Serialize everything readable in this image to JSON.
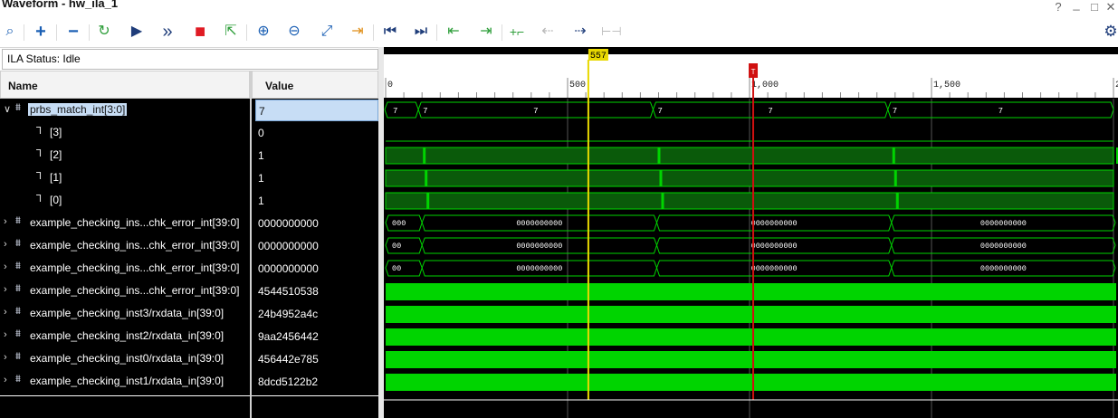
{
  "window": {
    "title": "Waveform - hw_ila_1",
    "controls": [
      "?",
      "_",
      "□",
      "✕"
    ]
  },
  "toolbar": {
    "buttons": [
      {
        "name": "search-icon",
        "glyph": "⌕"
      },
      {
        "name": "add-icon",
        "glyph": "+"
      },
      {
        "name": "remove-icon",
        "glyph": "−"
      },
      {
        "name": "run-trigger-immediate-icon",
        "glyph": "↻"
      },
      {
        "name": "run-trigger-icon",
        "glyph": "▶"
      },
      {
        "name": "run-trigger-all-icon",
        "glyph": "»"
      },
      {
        "name": "stop-icon",
        "glyph": "■"
      },
      {
        "name": "export-icon",
        "glyph": "⇱"
      },
      {
        "name": "zoom-in-icon",
        "glyph": "⊕"
      },
      {
        "name": "zoom-out-icon",
        "glyph": "⊖"
      },
      {
        "name": "zoom-fit-icon",
        "glyph": "⤢"
      },
      {
        "name": "go-to-cursor-icon",
        "glyph": "⇥"
      },
      {
        "name": "go-to-start-icon",
        "glyph": "⏮"
      },
      {
        "name": "go-to-end-icon",
        "glyph": "⏭"
      },
      {
        "name": "previous-transition-icon",
        "glyph": "⇤"
      },
      {
        "name": "next-transition-icon",
        "glyph": "⇥"
      },
      {
        "name": "add-marker-icon",
        "glyph": "+⌐"
      },
      {
        "name": "previous-marker-icon",
        "glyph": "⇠"
      },
      {
        "name": "next-marker-icon",
        "glyph": "⇢"
      },
      {
        "name": "swap-cursors-icon",
        "glyph": "⊢⊣"
      }
    ],
    "settings_icon": "⚙"
  },
  "status": {
    "text": "ILA Status: Idle"
  },
  "columns": {
    "name": "Name",
    "value": "Value"
  },
  "rows": [
    {
      "name": "prbs_match_int[3:0]",
      "value": "7",
      "type": "bus",
      "indent": 0,
      "selected": true
    },
    {
      "name": "[3]",
      "value": "0",
      "type": "bit",
      "indent": 1
    },
    {
      "name": "[2]",
      "value": "1",
      "type": "bit",
      "indent": 1
    },
    {
      "name": "[1]",
      "value": "1",
      "type": "bit",
      "indent": 1
    },
    {
      "name": "[0]",
      "value": "1",
      "type": "bit",
      "indent": 1
    },
    {
      "name": "example_checking_ins...chk_error_int[39:0]",
      "value": "0000000000",
      "type": "bus",
      "indent": 0
    },
    {
      "name": "example_checking_ins...chk_error_int[39:0]",
      "value": "0000000000",
      "type": "bus",
      "indent": 0
    },
    {
      "name": "example_checking_ins...chk_error_int[39:0]",
      "value": "0000000000",
      "type": "bus",
      "indent": 0
    },
    {
      "name": "example_checking_ins...chk_error_int[39:0]",
      "value": "4544510538",
      "type": "bus",
      "indent": 0
    },
    {
      "name": "example_checking_inst3/rxdata_in[39:0]",
      "value": "24b4952a4c",
      "type": "bus",
      "indent": 0
    },
    {
      "name": "example_checking_inst2/rxdata_in[39:0]",
      "value": "9aa2456442",
      "type": "bus",
      "indent": 0
    },
    {
      "name": "example_checking_inst0/rxdata_in[39:0]",
      "value": "456442e785",
      "type": "bus",
      "indent": 0
    },
    {
      "name": "example_checking_inst1/rxdata_in[39:0]",
      "value": "8dcd5122b2",
      "type": "bus",
      "indent": 0
    }
  ],
  "timeline": {
    "range": [
      0,
      2000
    ],
    "tick_labels": [
      {
        "value": 0,
        "label": "0"
      },
      {
        "value": 500,
        "label": "500"
      },
      {
        "value": 1000,
        "label": "1,000"
      },
      {
        "value": 1500,
        "label": "1,500"
      },
      {
        "value": 2000,
        "label": "2,0"
      }
    ],
    "cursor": {
      "value": 557,
      "label": "557",
      "color": "#e8d800"
    },
    "trigger": {
      "value": 1010,
      "label": "T",
      "color": "#d01010"
    }
  },
  "waves": {
    "bus0": {
      "segments": [
        [
          0,
          90,
          "7"
        ],
        [
          90,
          735,
          "7"
        ],
        [
          735,
          1380,
          "7"
        ],
        [
          1380,
          2000,
          "7"
        ]
      ],
      "first_label": "7"
    },
    "bit_row_indices": [
      2,
      3,
      4
    ],
    "bit_pulses": [
      95,
      740,
      1385,
      2000
    ],
    "chk_bus": [
      {
        "first": "000",
        "mid": "0000000000",
        "transitions": [
          95,
          740,
          1385,
          2000
        ]
      },
      {
        "first": "00",
        "mid": "0000000000",
        "transitions": [
          95,
          740,
          1385,
          2000
        ]
      },
      {
        "first": "00",
        "mid": "0000000000",
        "transitions": [
          95,
          740,
          1385,
          2000
        ]
      }
    ]
  },
  "colors": {
    "wave_green": "#00d400",
    "wave_dark_green": "#0a5a0a",
    "selected": "#c7ddf5"
  }
}
